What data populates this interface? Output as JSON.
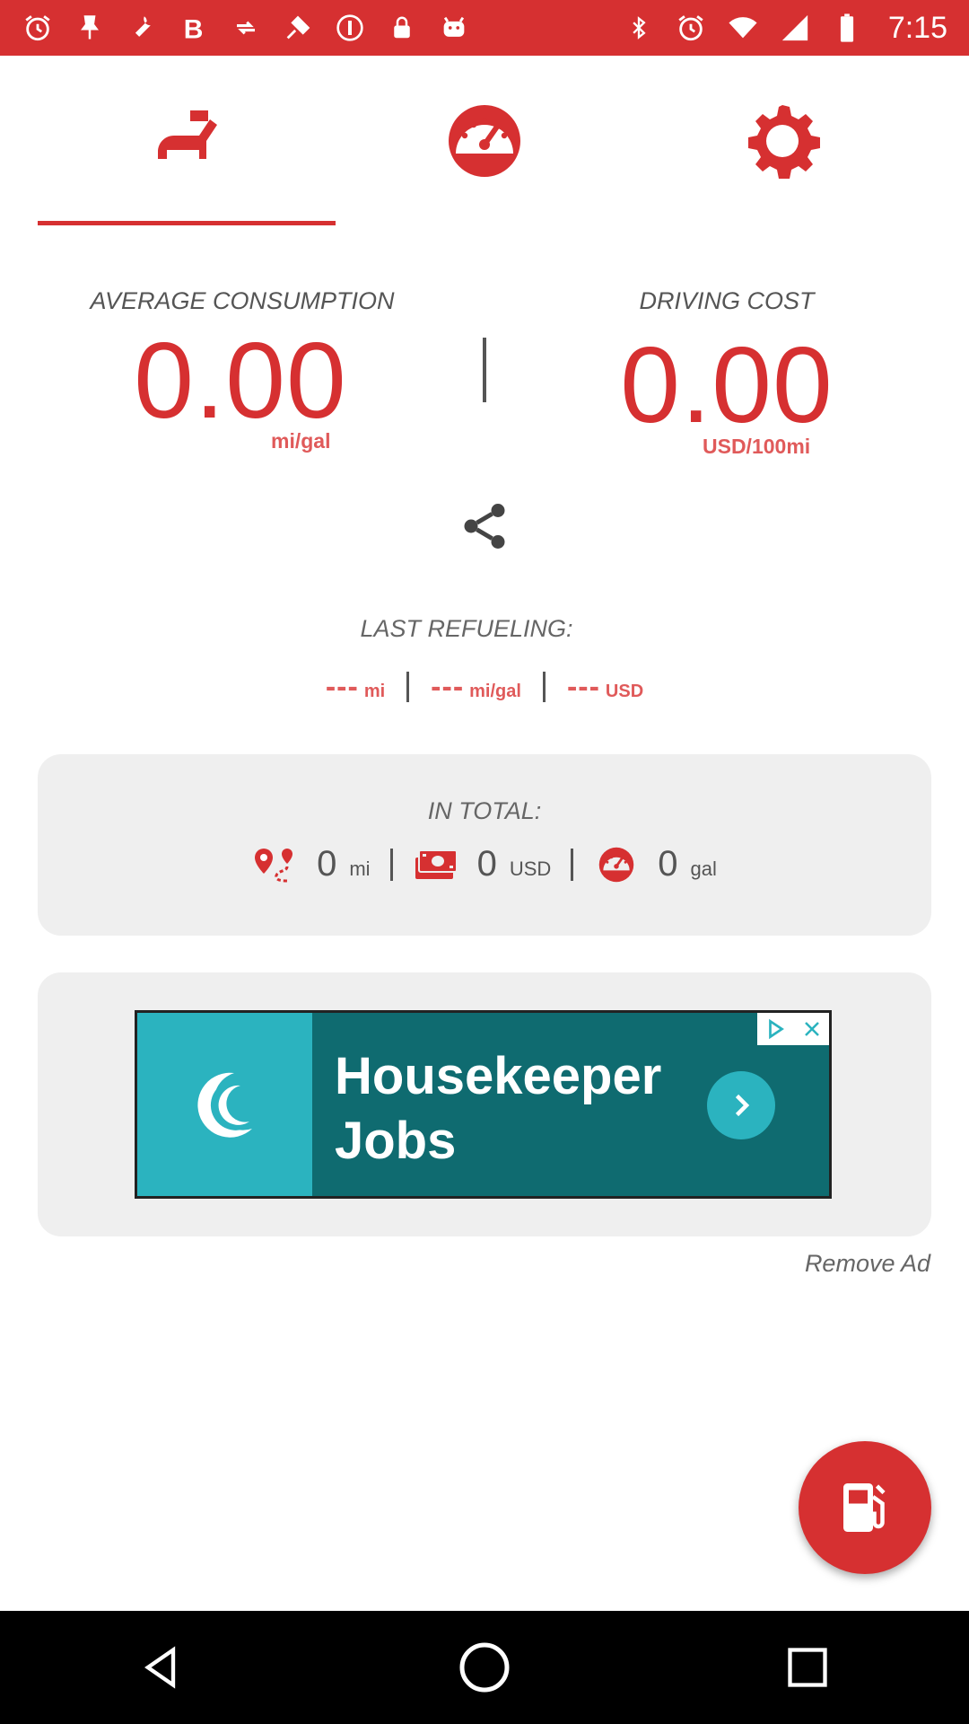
{
  "status_bar": {
    "time": "7:15",
    "left_icons": [
      "alarm-icon",
      "pin-icon",
      "wrench-icon",
      "bold-b-icon",
      "sync-icon",
      "fake-gps-icon",
      "circle-pause-icon",
      "lock-icon",
      "android-icon"
    ],
    "right_icons": [
      "bluetooth-icon",
      "alarm-icon"
    ]
  },
  "tabs": [
    {
      "name": "fuel-nozzle-tab",
      "icon": "fuel-nozzle-icon",
      "active": true
    },
    {
      "name": "gauge-tab",
      "icon": "speedometer-icon",
      "active": false
    },
    {
      "name": "settings-tab",
      "icon": "gear-icon",
      "active": false
    }
  ],
  "metrics": {
    "consumption": {
      "label": "AVERAGE CONSUMPTION",
      "value": "0.00",
      "unit": "mi/gal"
    },
    "cost": {
      "label": "DRIVING COST",
      "value": "0.00",
      "unit": "USD/100mi"
    }
  },
  "last_refueling": {
    "title": "LAST REFUELING:",
    "items": [
      {
        "value": "---",
        "unit": "mi"
      },
      {
        "value": "---",
        "unit": "mi/gal"
      },
      {
        "value": "---",
        "unit": "USD"
      }
    ]
  },
  "in_total": {
    "title": "IN TOTAL:",
    "items": [
      {
        "icon": "route-pin-icon",
        "value": "0",
        "unit": "mi"
      },
      {
        "icon": "money-icon",
        "value": "0",
        "unit": "USD"
      },
      {
        "icon": "gauge-icon",
        "value": "0",
        "unit": "gal"
      }
    ]
  },
  "ad": {
    "line1": "Housekeeper",
    "line2": "Jobs"
  },
  "remove_ad": "Remove Ad",
  "colors": {
    "accent": "#d63031",
    "accent_light": "#e05a5a",
    "card_bg": "#efefef",
    "ad_dark": "#0f6b70",
    "ad_light": "#2bb3bf"
  }
}
